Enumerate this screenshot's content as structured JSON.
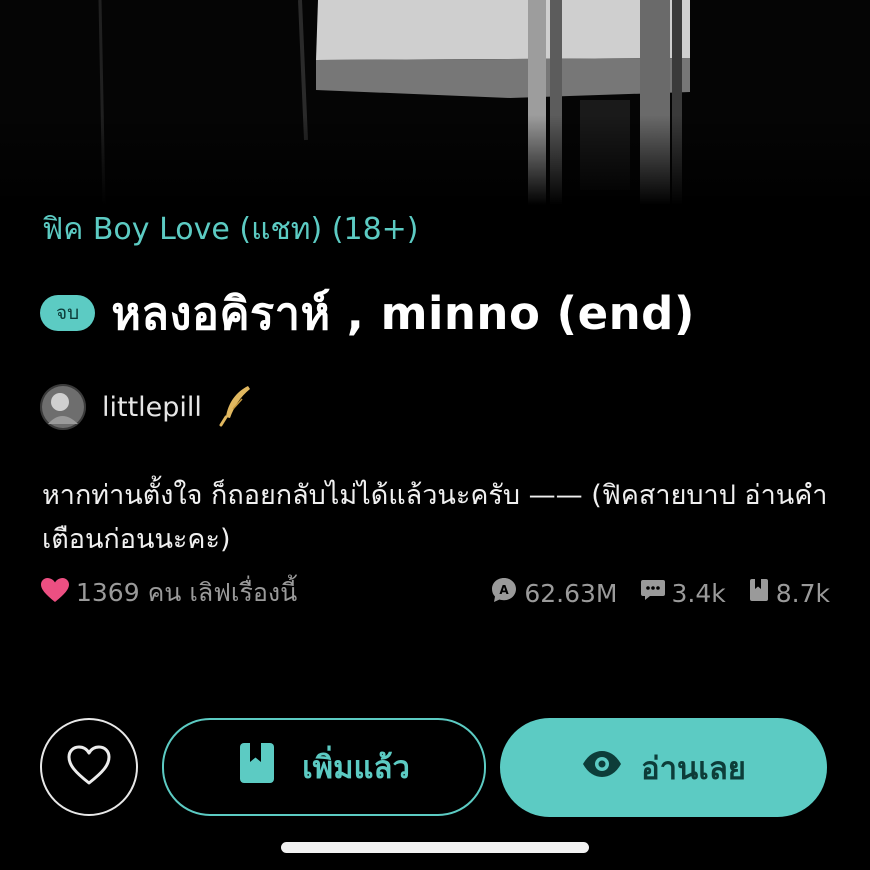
{
  "story": {
    "category": "ฟิค Boy Love (แชท) (18+)",
    "status_label": "จบ",
    "title": "หลงอคิราห์ , minno (end)",
    "author": "littlepill",
    "description": "หากท่านตั้งใจ ก็ถอยกลับไม่ได้แล้วนะครับ —— (ฟิคสายบาป อ่านคำเตือนก่อนนะคะ)"
  },
  "stats": {
    "likes_text": "1369 คน เลิฟเรื่องนี้",
    "views": "62.63M",
    "comments": "3.4k",
    "bookmarks": "8.7k"
  },
  "actions": {
    "library_label": "เพิ่มแล้ว",
    "read_label": "อ่านเลย"
  },
  "icons": {
    "like": "heart-outline-icon",
    "liked": "heart-filled-icon",
    "views": "view-count-icon",
    "comments": "comment-icon",
    "bookmarks": "bookmark-icon",
    "author_badge": "feather-quill-icon",
    "read": "eye-icon"
  },
  "colors": {
    "accent": "#5ccbc3",
    "heart": "#ec4f82",
    "background": "#000000",
    "muted_text": "#9a9a9a"
  }
}
